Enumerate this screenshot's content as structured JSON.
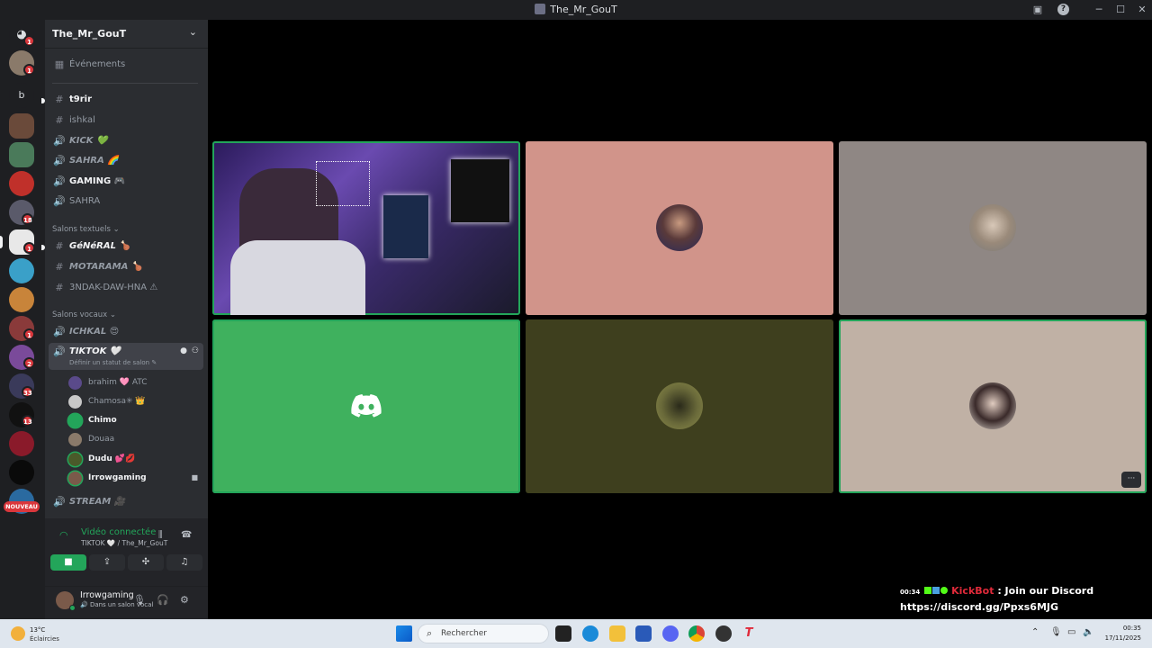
{
  "window": {
    "title": "The_Mr_GouT",
    "buttons": {
      "inbox": "▣",
      "help": "?",
      "minimize": "─",
      "maximize": "☐",
      "close": "✕"
    }
  },
  "rail": {
    "badges": [
      "1",
      "1",
      "1",
      "18",
      "1",
      "1",
      "2",
      "33",
      "13"
    ],
    "letter_server": "b",
    "new_label": "NOUVEAU"
  },
  "server": {
    "name": "The_Mr_GouT",
    "chevron": "⌄"
  },
  "sidebar": {
    "events_label": "Événements",
    "top_channels": [
      {
        "icon": "#",
        "label": "t9rir",
        "unread": true
      },
      {
        "icon": "#",
        "label": "ishkal",
        "unread": false
      },
      {
        "icon": "🔊",
        "label": "KICK 💚",
        "italic": true
      },
      {
        "icon": "🔊",
        "label": "SAHRA 🌈",
        "italic": true
      },
      {
        "icon": "🔊",
        "label": "GAMING 🎮",
        "italic": false,
        "unread": true
      },
      {
        "icon": "🔊",
        "label": "SAHRA",
        "italic": false
      }
    ],
    "text_category": "Salons textuels ⌄",
    "text_channels": [
      {
        "icon": "#",
        "label": "GéNéRAL 🍗"
      },
      {
        "icon": "#",
        "label": "MOTARAMA 🍗"
      },
      {
        "icon": "#",
        "label": "3NDAK-DAW-HNA ⚠"
      }
    ],
    "voice_category": "Salons vocaux ⌄",
    "voice_channels": {
      "ichkal": "ICHKAL 😍",
      "tiktok": "TIKTOK 🤍",
      "tiktok_status": "Définir un statut de salon ✎",
      "stream": "STREAM 🎥"
    },
    "members": [
      {
        "name": "brahim 🩷 ATC",
        "highlight": false
      },
      {
        "name": "Chamosa✳ 👑",
        "highlight": false
      },
      {
        "name": "Chimo",
        "highlight": true
      },
      {
        "name": "Douaa",
        "highlight": false
      },
      {
        "name": "Dudu 💕💋",
        "highlight": true
      },
      {
        "name": "Irrowgaming",
        "highlight": true
      }
    ]
  },
  "voice_panel": {
    "status": "Vidéo connectée",
    "channel": "TIKTOK 🤍 / The_Mr_GouT"
  },
  "user_panel": {
    "username": "Irrowgaming",
    "status": "🔊 Dans un salon vocal"
  },
  "tiles": {
    "more_label": "···"
  },
  "overlay": {
    "time": "00:34",
    "bot": "KickBot",
    "message": " : Join our Discord",
    "link": "https://discord.gg/Ppxs6MJG"
  },
  "taskbar": {
    "temp": "13°C",
    "weather": "Éclaircies",
    "search_placeholder": "Rechercher",
    "clock_time": "00:35",
    "clock_date": "17/11/2025"
  },
  "colors": {
    "speaking": "#23a55a",
    "discord_blurple": "#5865f2",
    "badge_red": "#da373c"
  }
}
